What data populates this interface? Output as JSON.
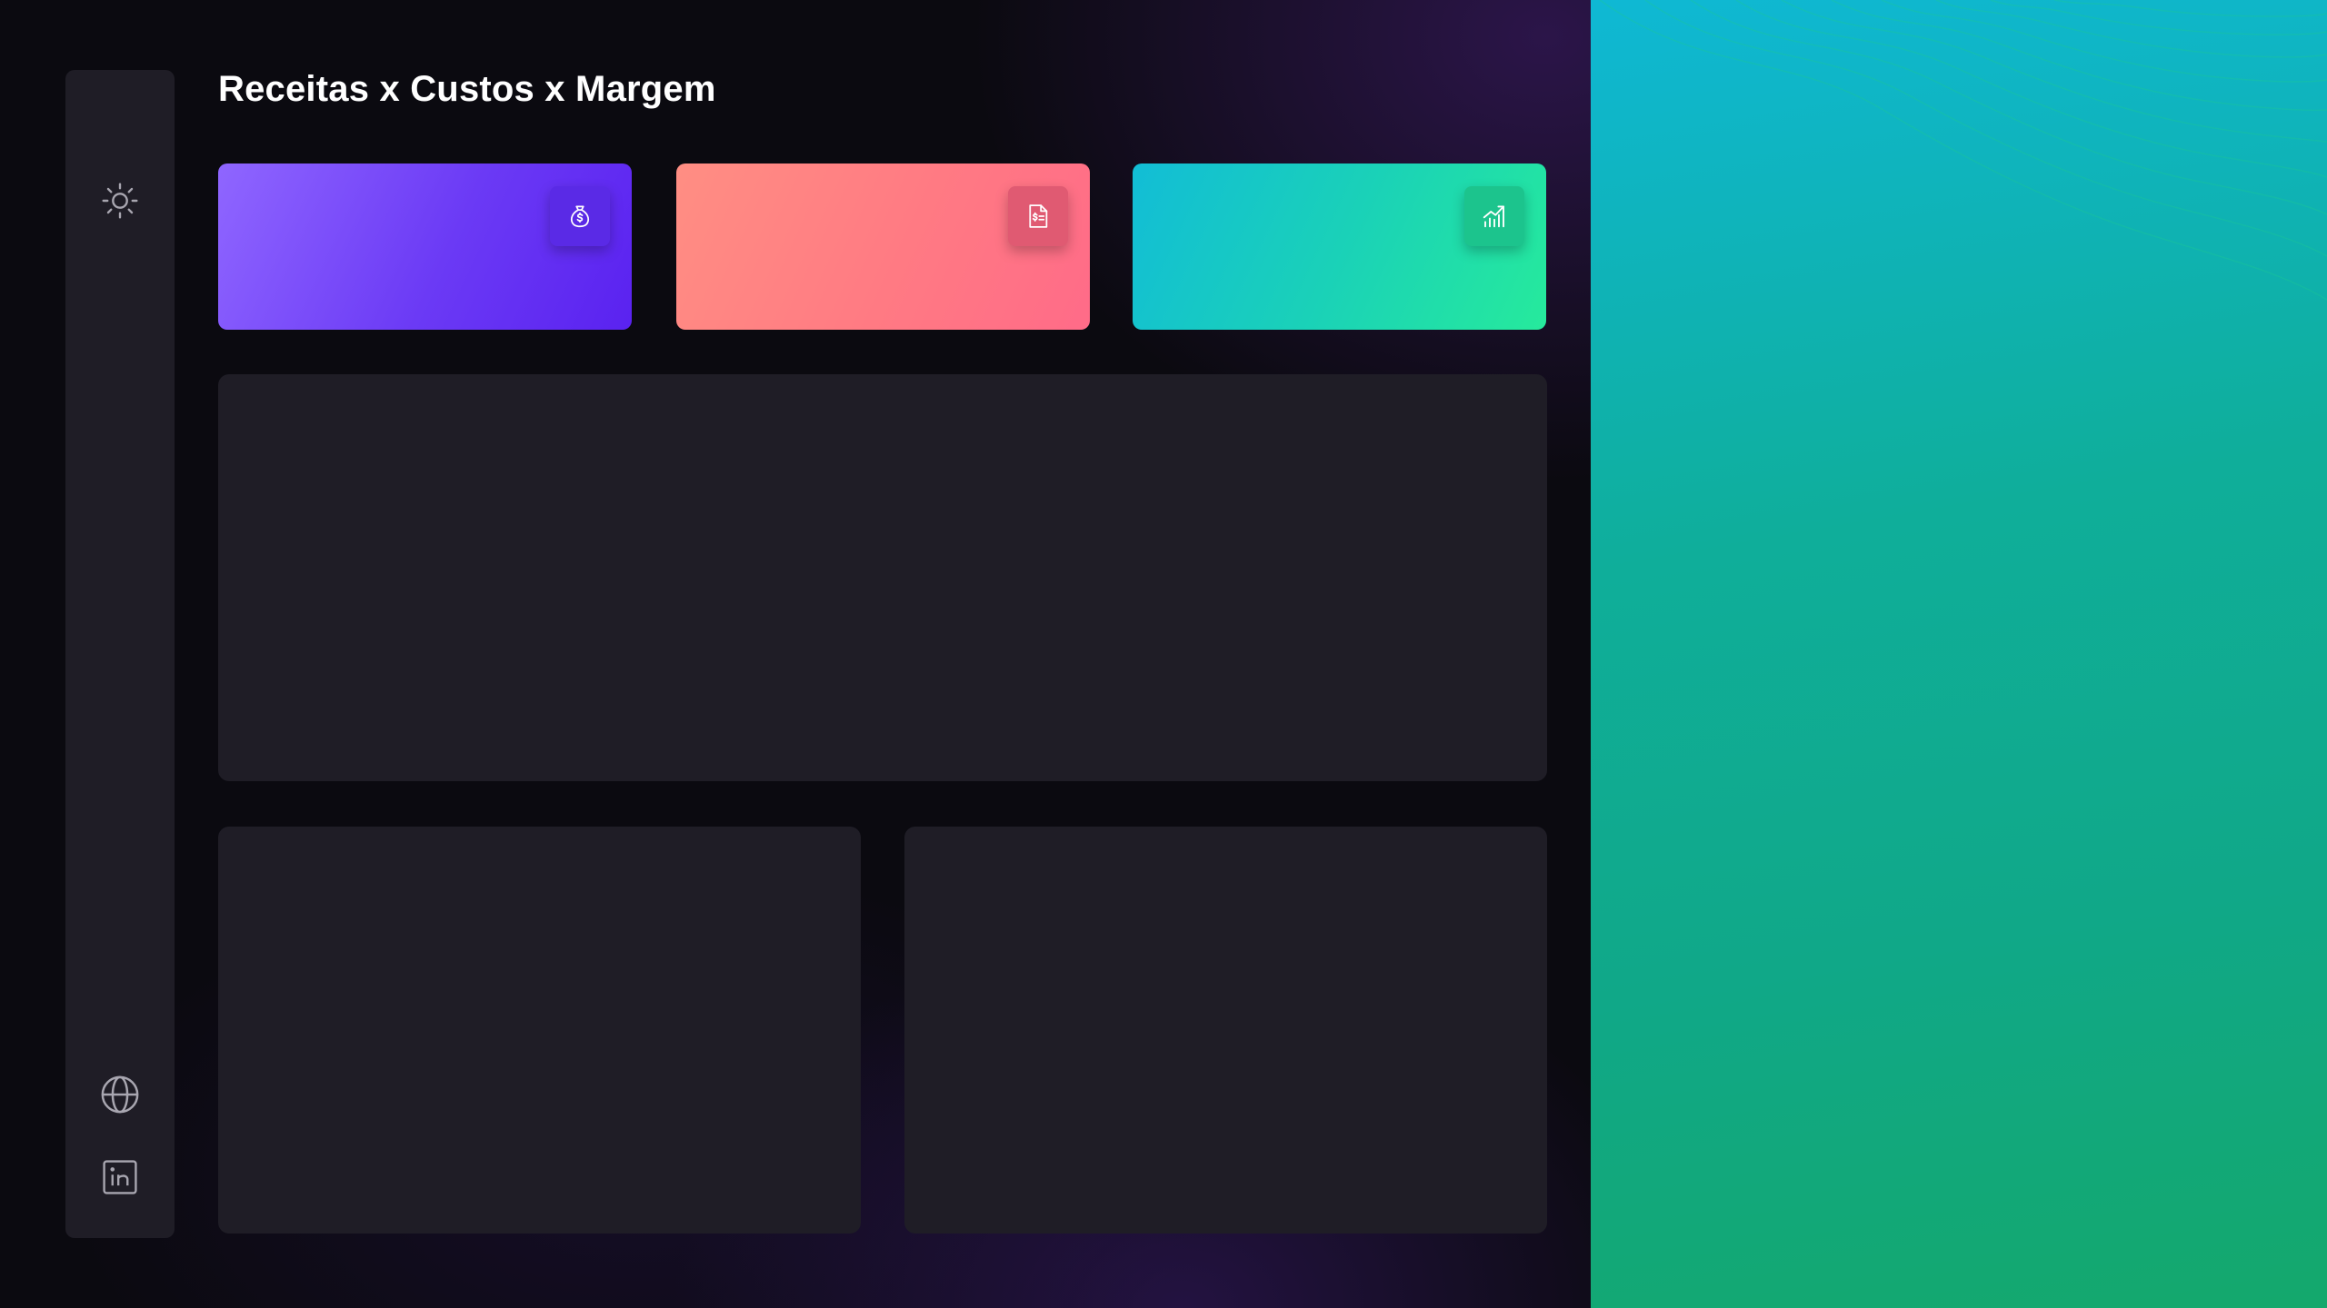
{
  "page": {
    "title": "Receitas x Custos x Margem"
  },
  "sidebar": {
    "top_icon": "sun-icon",
    "bottom_icons": [
      "globe-icon",
      "linkedin-icon"
    ]
  },
  "kpi_cards": [
    {
      "id": "receitas",
      "icon": "money-bag-icon",
      "value": ""
    },
    {
      "id": "custos",
      "icon": "invoice-dollar-icon",
      "value": ""
    },
    {
      "id": "margem",
      "icon": "growth-chart-icon",
      "value": ""
    }
  ],
  "colors": {
    "background": "#0b0a10",
    "panel": "#1f1d26",
    "kpi_receitas": [
      "#8f66ff",
      "#5a22f0"
    ],
    "kpi_custos": [
      "#ff8e83",
      "#ff6b88"
    ],
    "kpi_margem": [
      "#12bdd6",
      "#26ea9c"
    ],
    "right_background": [
      "#0fb8d4",
      "#14a86c"
    ]
  }
}
